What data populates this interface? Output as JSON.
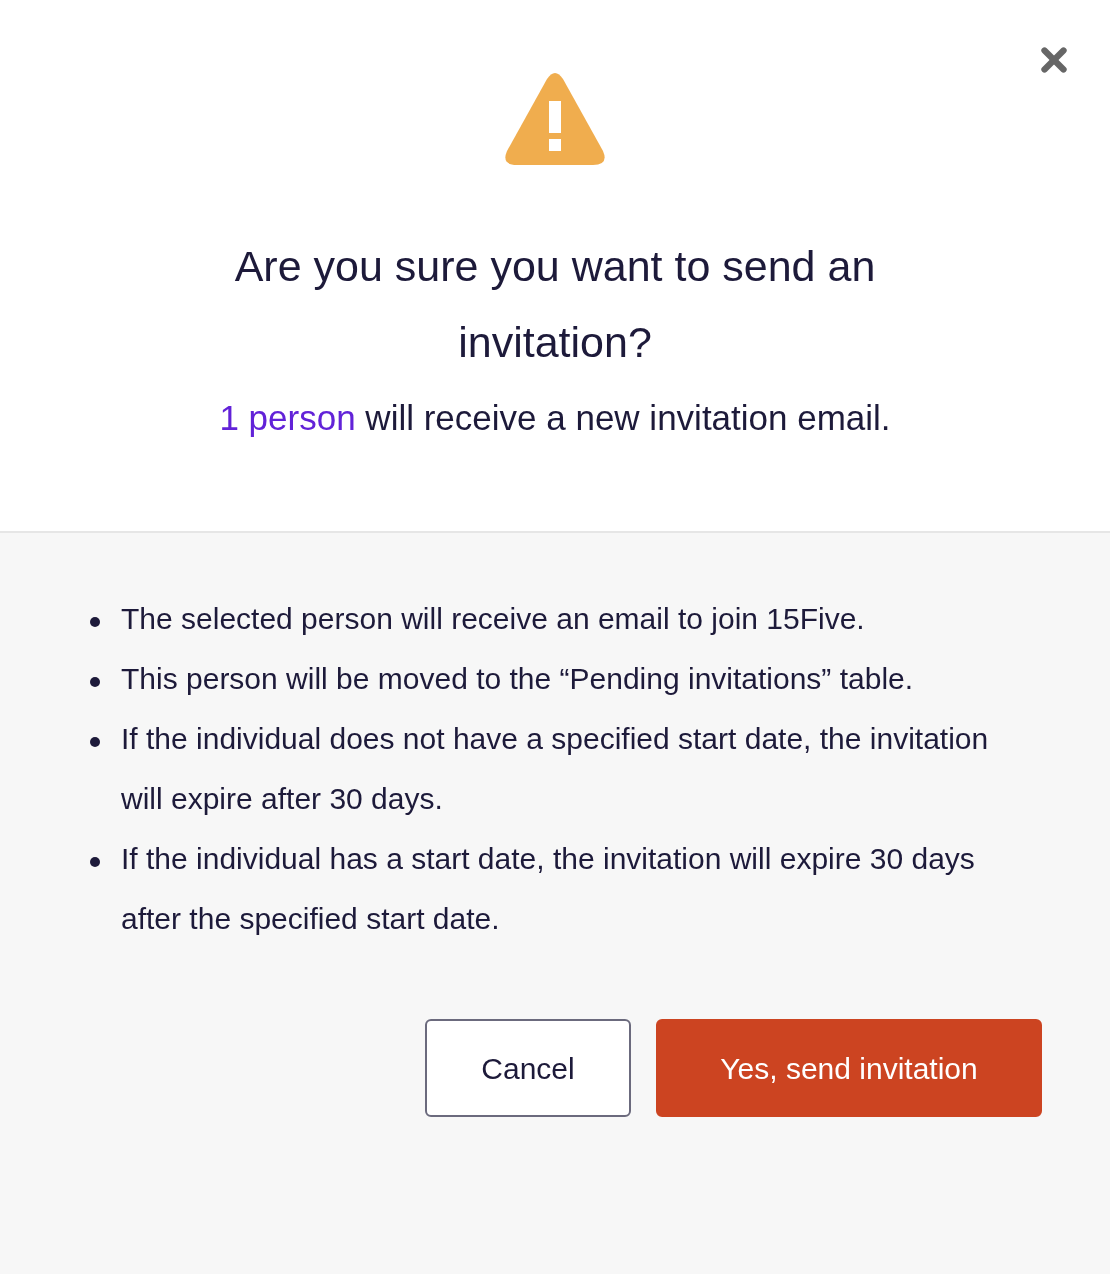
{
  "dialog": {
    "title": "Are you sure you want to send an invitation?",
    "summary": {
      "count_link": "1 person",
      "rest": "will receive a new invitation email."
    },
    "notes": [
      "The selected person will receive an email to join 15Five.",
      "This person will be moved to the “Pending invitations” table.",
      "If the individual does not have a specified start date, the invitation will expire after 30 days.",
      "If the individual has a start date, the invitation will expire 30 days after the specified start date."
    ],
    "buttons": [
      {
        "label": "Cancel",
        "kind": "secondary"
      },
      {
        "label": "Yes, send invitation",
        "kind": "primary"
      }
    ]
  }
}
